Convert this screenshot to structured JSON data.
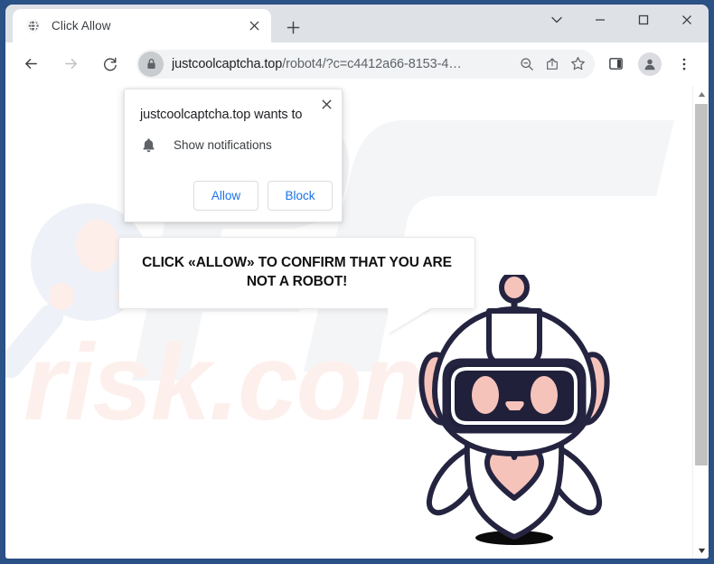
{
  "window": {
    "controls": [
      {
        "name": "tab-search",
        "label": "∨",
        "icon": "chevron-down-icon"
      },
      {
        "name": "minimize",
        "label": "—",
        "icon": "minimize-icon"
      },
      {
        "name": "maximize",
        "label": "□",
        "icon": "maximize-icon"
      },
      {
        "name": "close",
        "label": "×",
        "icon": "close-icon"
      }
    ],
    "frame_color": "#2b5287"
  },
  "tabstrip": {
    "tabs": [
      {
        "title": "Click Allow",
        "favicon": "globe-icon",
        "close_label": "×"
      }
    ],
    "new_tab_label": "+"
  },
  "toolbar": {
    "back_icon": "arrow-left-icon",
    "forward_icon": "arrow-right-icon",
    "reload_icon": "reload-icon",
    "lock_icon": "lock-icon",
    "url_host": "justcoolcaptcha.top",
    "url_path": "/robot4/?c=c4412a66-8153-4…",
    "url_full": "justcoolcaptcha.top/robot4/?c=c4412a66-8153-4…",
    "right_icons": [
      {
        "name": "zoom-out-icon",
        "title": "zoom out"
      },
      {
        "name": "share-icon",
        "title": "share"
      },
      {
        "name": "bookmark-star-icon",
        "title": "bookmark"
      },
      {
        "name": "side-panel-icon",
        "title": "side panel"
      },
      {
        "name": "profile-avatar-icon",
        "title": "profile"
      },
      {
        "name": "more-menu-icon",
        "title": "customize and control"
      }
    ]
  },
  "notification_dialog": {
    "title": "justcoolcaptcha.top wants to",
    "permission_label": "Show notifications",
    "permission_icon": "bell-icon",
    "close_label": "×",
    "buttons": [
      {
        "name": "allow-button",
        "label": "Allow"
      },
      {
        "name": "block-button",
        "label": "Block"
      }
    ],
    "link_color": "#1a73e8"
  },
  "page": {
    "bubble_text": "CLICK «ALLOW» TO CONFIRM THAT YOU ARE NOT A ROBOT!",
    "watermark_text": "risk.com",
    "watermark_logo": "PC",
    "mascot": "robot-mascot",
    "colors": {
      "robot_outline": "#242440",
      "robot_pink": "#f6c3bb",
      "robot_face": "#20203a",
      "robot_body": "#ffffff",
      "watermark_pink": "#fdf0ec",
      "watermark_gray": "#f4f5f7"
    }
  },
  "scrollbar": {
    "up_arrow": "▲",
    "down_arrow": "▼"
  }
}
